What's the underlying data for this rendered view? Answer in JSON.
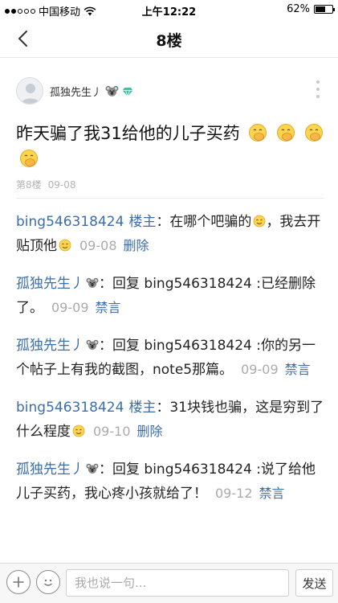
{
  "status_bar": {
    "carrier": "中国移动",
    "time": "上午12:22",
    "battery_text": "62%",
    "battery_level": 0.62,
    "signal_bars_filled": 2,
    "signal_bars_total": 5
  },
  "nav": {
    "title": "8楼"
  },
  "floor": {
    "author": "孤独先生丿",
    "content": "昨天骗了我31给他的儿子买药",
    "floor_label": "第8楼",
    "date": "09-08"
  },
  "replies": [
    {
      "user": "bing546318424",
      "role": "楼主",
      "text_a": "：在哪个吧骗的",
      "text_b": "，我去开贴顶他",
      "date": "09-08",
      "action": "删除"
    },
    {
      "user": "孤独先生丿",
      "text": "：回复 bing546318424 :已经删除了。",
      "date": "09-09",
      "action": "禁言"
    },
    {
      "user": "孤独先生丿",
      "text": "：回复 bing546318424 :你的另一个帖子上有我的截图，note5那篇。",
      "date": "09-09",
      "action": "禁言"
    },
    {
      "user": "bing546318424",
      "role": "楼主",
      "text": "：31块钱也骗，这是穷到了什么程度",
      "date": "09-10",
      "action": "删除"
    },
    {
      "user": "孤独先生丿",
      "text": "：回复 bing546318424 :说了给他儿子买药，我心疼小孩就给了！",
      "date": "09-12",
      "action": "禁言"
    }
  ],
  "bottom_bar": {
    "input_placeholder": "我也说一句...",
    "send_label": "发送"
  },
  "icons": {
    "back": "chevron-left-icon",
    "more": "more-vertical-icon",
    "add": "plus-icon",
    "emoji": "smiley-icon",
    "koala": "koala-icon",
    "gem": "gem-icon",
    "hand_over_mouth": "hand-over-mouth-emoji",
    "happy_face": "happy-face-emoji"
  },
  "colors": {
    "link": "#3b6eaa",
    "meta": "#aaaaaa",
    "gem": "#3cc4a4"
  }
}
